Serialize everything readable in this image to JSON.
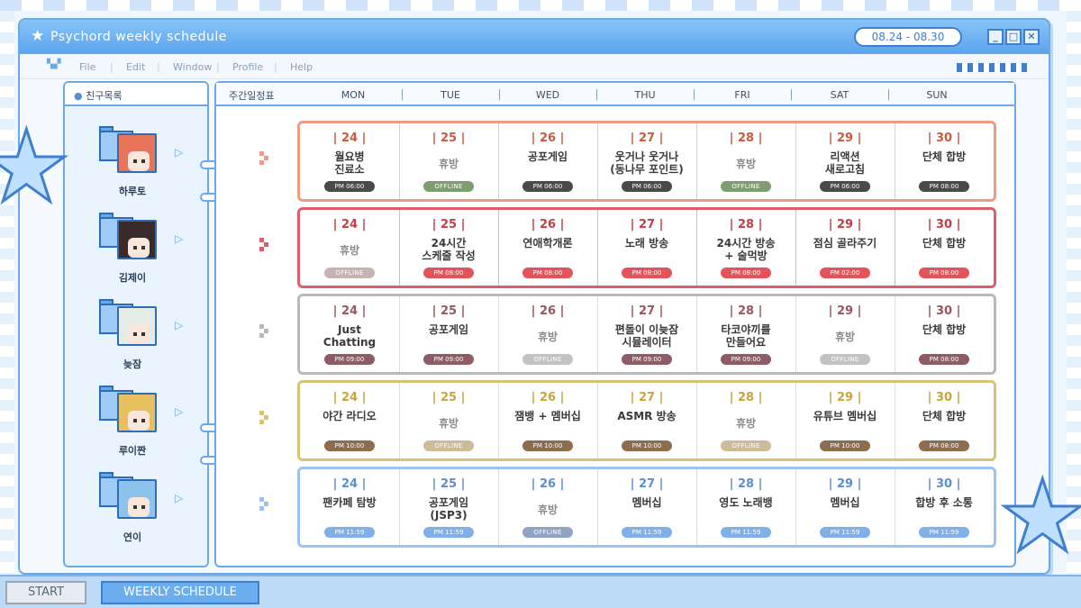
{
  "window": {
    "title": "Psychord weekly schedule",
    "date_range": "08.24 - 08.30",
    "controls": {
      "minimize": "_",
      "maximize": "□",
      "close": "✕"
    }
  },
  "menu": [
    "File",
    "Edit",
    "Window",
    "Profile",
    "Help"
  ],
  "sidebar": {
    "title": "친구목록",
    "friends": [
      {
        "name": "하루토",
        "hair": "#e8745a"
      },
      {
        "name": "김제이",
        "hair": "#3a2a2a"
      },
      {
        "name": "늦잠",
        "hair": "#e4ece6"
      },
      {
        "name": "루이짠",
        "hair": "#e8c060"
      },
      {
        "name": "연이",
        "hair": "#8cc4ee"
      }
    ]
  },
  "schedule": {
    "label": "주간일정표",
    "days": [
      "MON",
      "TUE",
      "WED",
      "THU",
      "FRI",
      "SAT",
      "SUN"
    ],
    "rows": [
      {
        "color": "#ef9a84",
        "text": "#c95a3e",
        "badge": "#4a4a4a",
        "off": "#7e9e72",
        "divider": "#f2c7ba",
        "cells": [
          {
            "num": "| 24 |",
            "act": "월요병\n진료소",
            "time": "PM 06:00"
          },
          {
            "num": "| 25 |",
            "act": "휴방",
            "time": "OFFLINE",
            "rest": true
          },
          {
            "num": "| 26 |",
            "act": "공포게임",
            "time": "PM 06:00"
          },
          {
            "num": "| 27 |",
            "act": "웃거나 웃거나\n(동나무 포인트)",
            "time": "PM 06:00"
          },
          {
            "num": "| 28 |",
            "act": "휴방",
            "time": "OFFLINE",
            "rest": true
          },
          {
            "num": "| 29 |",
            "act": "리액션\n새로고침",
            "time": "PM 06:00"
          },
          {
            "num": "| 30 |",
            "act": "단체 합방",
            "time": "PM 08:00"
          }
        ]
      },
      {
        "color": "#d9606a",
        "text": "#c23e48",
        "badge": "#e2545a",
        "off": "#c8b3b3",
        "divider": "#eab2b6",
        "cells": [
          {
            "num": "| 24 |",
            "act": "휴방",
            "time": "OFFLINE",
            "rest": true
          },
          {
            "num": "| 25 |",
            "act": "24시간\n스케줄 작성",
            "time": "PM 08:00"
          },
          {
            "num": "| 26 |",
            "act": "연애학개론",
            "time": "PM 08:00"
          },
          {
            "num": "| 27 |",
            "act": "노래 방송",
            "time": "PM 08:00"
          },
          {
            "num": "| 28 |",
            "act": "24시간 방송\n+ 술먹방",
            "time": "PM 08:00"
          },
          {
            "num": "| 29 |",
            "act": "점심 골라주기",
            "time": "PM 02:00"
          },
          {
            "num": "| 30 |",
            "act": "단체 합방",
            "time": "PM 08:00"
          }
        ]
      },
      {
        "color": "#b9b9b9",
        "text": "#9a5560",
        "badge": "#8e5b66",
        "off": "#c2c2c2",
        "divider": "#dedede",
        "cells": [
          {
            "num": "| 24 |",
            "act": "Just\nChatting",
            "time": "PM 09:00"
          },
          {
            "num": "| 25 |",
            "act": "공포게임",
            "time": "PM 09:00"
          },
          {
            "num": "| 26 |",
            "act": "휴방",
            "time": "OFFLINE",
            "rest": true
          },
          {
            "num": "| 27 |",
            "act": "편돌이 이늦잠\n시뮬레이터",
            "time": "PM 09:00"
          },
          {
            "num": "| 28 |",
            "act": "타코야끼를\n만들어요",
            "time": "PM 09:00"
          },
          {
            "num": "| 29 |",
            "act": "휴방",
            "time": "OFFLINE",
            "rest": true
          },
          {
            "num": "| 30 |",
            "act": "단체 합방",
            "time": "PM 08:00"
          }
        ]
      },
      {
        "color": "#d8c274",
        "text": "#c6a53a",
        "badge": "#8e6d4e",
        "off": "#cdbb9a",
        "divider": "#ece0b4",
        "cells": [
          {
            "num": "| 24 |",
            "act": "야간 라디오",
            "time": "PM 10:00"
          },
          {
            "num": "| 25 |",
            "act": "휴방",
            "time": "OFFLINE",
            "rest": true
          },
          {
            "num": "| 26 |",
            "act": "잼뱅 + 멤버십",
            "time": "PM 10:00"
          },
          {
            "num": "| 27 |",
            "act": "ASMR 방송",
            "time": "PM 10:00"
          },
          {
            "num": "| 28 |",
            "act": "휴방",
            "time": "OFFLINE",
            "rest": true
          },
          {
            "num": "| 29 |",
            "act": "유튜브 멤버십",
            "time": "PM 10:00"
          },
          {
            "num": "| 30 |",
            "act": "단체 합방",
            "time": "PM 08:00"
          }
        ]
      },
      {
        "color": "#9cc3ef",
        "text": "#5b8fd0",
        "badge": "#7fb0ea",
        "off": "#8ea4c4",
        "divider": "#cde0f6",
        "cells": [
          {
            "num": "| 24 |",
            "act": "팬카페 탐방",
            "time": "PM 11:59"
          },
          {
            "num": "| 25 |",
            "act": "공포게임\n(JSP3)",
            "time": "PM 11:59"
          },
          {
            "num": "| 26 |",
            "act": "휴방",
            "time": "OFFLINE",
            "rest": true
          },
          {
            "num": "| 27 |",
            "act": "멤버십",
            "time": "PM 11:59"
          },
          {
            "num": "| 28 |",
            "act": "영도 노래뱅",
            "time": "PM 11:59"
          },
          {
            "num": "| 29 |",
            "act": "멤버십",
            "time": "PM 11:59"
          },
          {
            "num": "| 30 |",
            "act": "합방 후 소통",
            "time": "PM 11:59"
          }
        ]
      }
    ]
  },
  "taskbar": {
    "start": "START",
    "task": "WEEKLY SCHEDULE"
  }
}
